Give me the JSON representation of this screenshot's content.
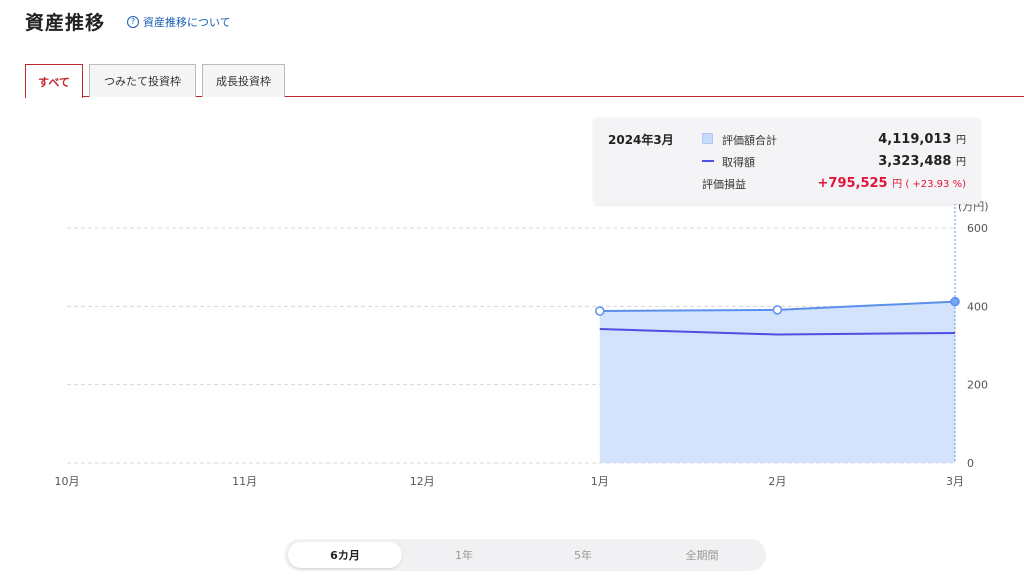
{
  "header": {
    "title": "資産推移",
    "help_icon": "?",
    "help_link": "資産推移について"
  },
  "tabs": [
    {
      "label": "すべて",
      "active": true
    },
    {
      "label": "つみたて投資枠",
      "active": false
    },
    {
      "label": "成長投資枠",
      "active": false
    }
  ],
  "tooltip": {
    "date": "2024年3月",
    "rows": [
      {
        "label": "評価額合計",
        "value": "4,119,013",
        "unit": "円"
      },
      {
        "label": "取得額",
        "value": "3,323,488",
        "unit": "円"
      },
      {
        "label": "評価損益",
        "value": "+795,525",
        "unit": "円",
        "extra": " ( +23.93 %)"
      }
    ]
  },
  "period_selector": [
    {
      "label": "6カ月",
      "active": true
    },
    {
      "label": "1年",
      "active": false
    },
    {
      "label": "5年",
      "active": false
    },
    {
      "label": "全期間",
      "active": false
    }
  ],
  "colors": {
    "accent_red": "#c0262c",
    "area_fill": "#d3e3fb",
    "area_line": "#5b8fee",
    "cost_line": "#4f4fe0",
    "profit": "#e0143c"
  },
  "chart_data": {
    "type": "area",
    "categories": [
      "10月",
      "11月",
      "12月",
      "1月",
      "2月",
      "3月"
    ],
    "ylabel": "(万円)",
    "yticks": [
      0,
      200,
      400,
      600
    ],
    "ylim": [
      0,
      600
    ],
    "series": [
      {
        "name": "評価額合計",
        "kind": "area",
        "values": [
          null,
          null,
          null,
          388,
          391,
          412
        ]
      },
      {
        "name": "取得額",
        "kind": "line",
        "values": [
          null,
          null,
          null,
          342,
          328,
          332
        ]
      }
    ]
  }
}
